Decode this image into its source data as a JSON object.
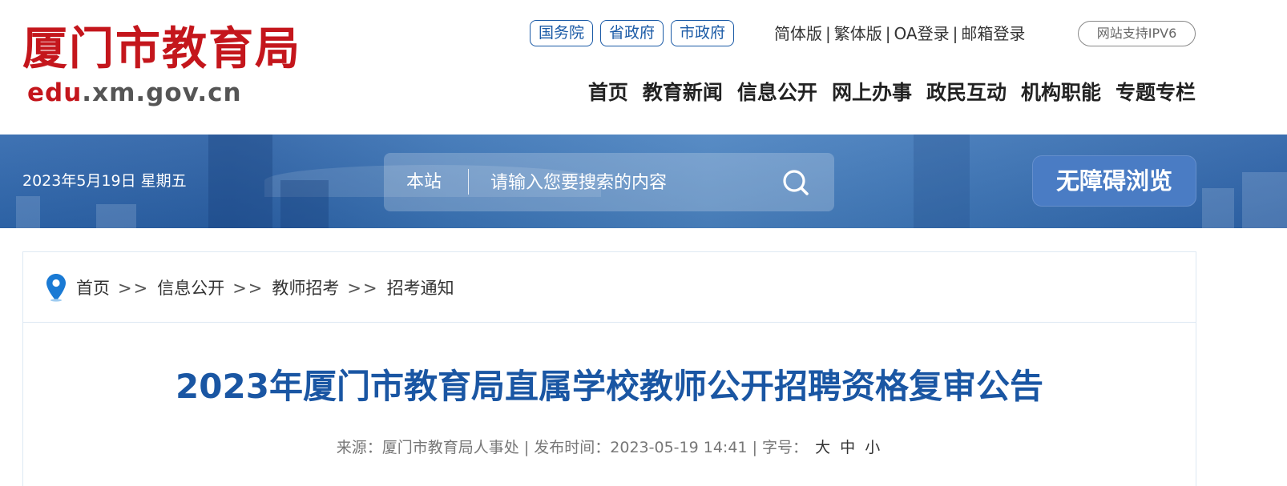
{
  "header": {
    "logo_cn": "厦门市教育局",
    "logo_url_red": "edu",
    "logo_url_rest": ".xm.gov.cn",
    "gov_links": [
      "国务院",
      "省政府",
      "市政府"
    ],
    "top_links": [
      "简体版",
      "繁体版",
      "OA登录",
      "邮箱登录"
    ],
    "ipv6": "网站支持IPV6",
    "nav": [
      "首页",
      "教育新闻",
      "信息公开",
      "网上办事",
      "政民互动",
      "机构职能",
      "专题专栏"
    ]
  },
  "banner": {
    "date": "2023年5月19日 星期五",
    "search_scope": "本站",
    "search_placeholder": "请输入您要搜索的内容",
    "accessibility": "无障碍浏览"
  },
  "breadcrumb": [
    "首页",
    "信息公开",
    "教师招考",
    "招考通知"
  ],
  "breadcrumb_sep": ">>",
  "article": {
    "title": "2023年厦门市教育局直属学校教师公开招聘资格复审公告",
    "source_label": "来源：厦门市教育局人事处",
    "date_label": "发布时间：2023-05-19 14:41",
    "font_label": "字号：",
    "font_large": "大",
    "font_medium": "中",
    "font_small": "小"
  },
  "colors": {
    "brand_red": "#c4161c",
    "title_blue": "#1a56a3",
    "banner_blue": "#2f67ad"
  },
  "icons": [
    "search-icon",
    "location-pin-icon"
  ]
}
